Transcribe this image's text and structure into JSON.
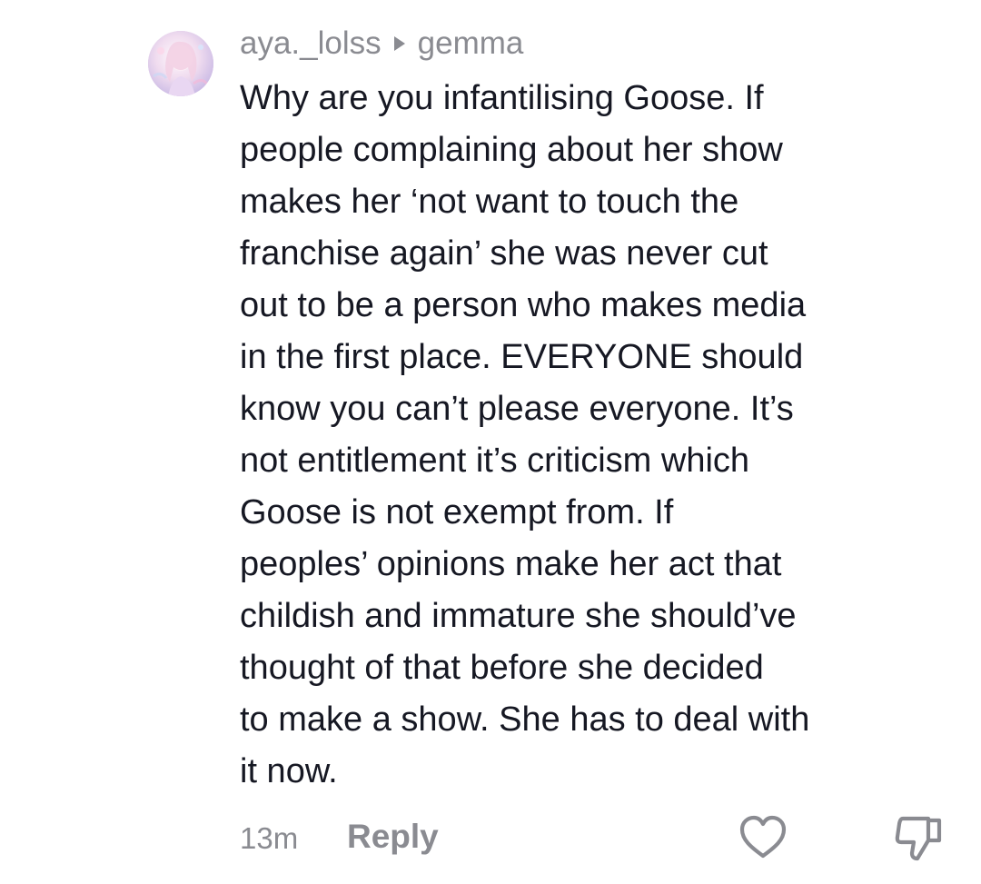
{
  "comment": {
    "username": "aya._lolss",
    "reply_to": "gemma",
    "reply_arrow_icon": "triangle-right-icon",
    "text": "Why are you infantilising Goose. If\npeople complaining about her show\nmakes her ‘not want to touch the\nfranchise again’ she was never cut\nout to be a person who makes media\nin the first place. EVERYONE should\nknow you can’t please everyone. It’s\nnot entitlement it’s criticism which\nGoose is not exempt from. If\npeoples’ opinions make her act that\nchildish and immature she should’ve\nthought of that before she decided\nto make a show. She has to deal with\nit now.",
    "timestamp": "13m",
    "reply_label": "Reply",
    "like_icon": "heart-outline-icon",
    "dislike_icon": "thumbs-down-outline-icon"
  },
  "colors": {
    "text": "#161823",
    "muted": "#8a8b91",
    "background": "#ffffff"
  }
}
